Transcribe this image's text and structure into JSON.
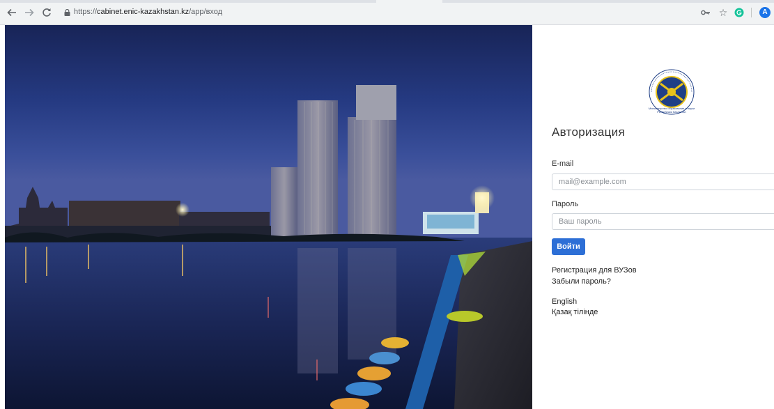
{
  "browser": {
    "url_scheme": "https://",
    "url_host": "cabinet.enic-kazakhstan.kz",
    "url_path": "/app/вход",
    "profile_initial": "A"
  },
  "icons": {
    "back": "arrow-left",
    "forward": "arrow-right",
    "reload": "reload",
    "lock": "lock",
    "key": "key",
    "bookmark": "star",
    "extension": "grammarly-circle",
    "profile": "avatar"
  },
  "colors": {
    "primary_button": "#2d6fd6",
    "emblem_blue": "#1f3f86",
    "emblem_gold": "#e8c21a"
  },
  "login": {
    "title": "Авторизация",
    "email_label": "E-mail",
    "email_placeholder": "mail@example.com",
    "email_value": "",
    "password_label": "Пароль",
    "password_placeholder": "Ваш пароль",
    "password_value": "",
    "submit_label": "Войти",
    "register_link": "Регистрация для ВУЗов",
    "forgot_link": "Забыли пароль?"
  },
  "languages": {
    "english": "English",
    "kazakh": "Қазақ тілінде"
  },
  "emblem": {
    "caption_line1": "Министерство образования и науки",
    "caption_line2": "Республики Казахстан"
  }
}
